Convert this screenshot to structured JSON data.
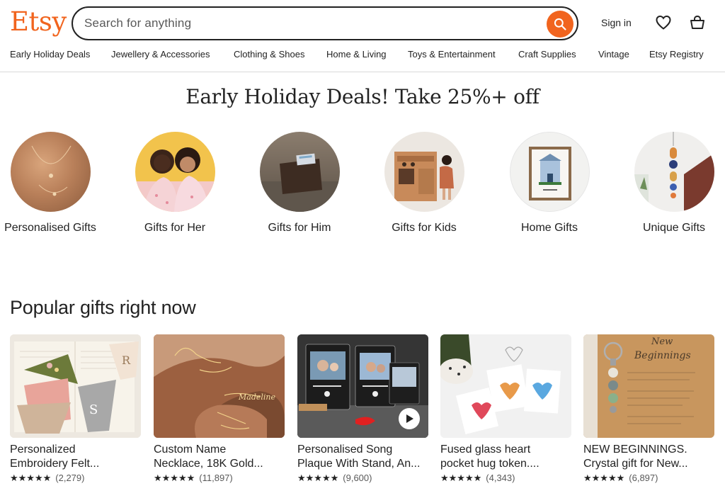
{
  "header": {
    "logo": "Etsy",
    "search_placeholder": "Search for anything",
    "signin_label": "Sign in",
    "icons": [
      "search-icon",
      "heart-icon",
      "shopping-bag-icon"
    ],
    "accent_color": "#f1641e"
  },
  "nav": {
    "items": [
      "Early Holiday Deals",
      "Jewellery & Accessories",
      "Clothing & Shoes",
      "Home & Living",
      "Toys & Entertainment",
      "Craft Supplies",
      "Vintage",
      "Etsy Registry"
    ]
  },
  "banner": {
    "title": "Early Holiday Deals! Take 25%+ off",
    "categories": [
      {
        "label": "Personalised Gifts"
      },
      {
        "label": "Gifts for Her"
      },
      {
        "label": "Gifts for Him"
      },
      {
        "label": "Gifts for Kids"
      },
      {
        "label": "Home Gifts"
      },
      {
        "label": "Unique Gifts"
      }
    ]
  },
  "popular": {
    "title": "Popular gifts right now",
    "items": [
      {
        "title_line1": "Personalized",
        "title_line2": "Embroidery Felt...",
        "stars": "★★★★★",
        "reviews": "(2,279)"
      },
      {
        "title_line1": "Custom Name",
        "title_line2": "Necklace, 18K Gold...",
        "stars": "★★★★★",
        "reviews": "(11,897)"
      },
      {
        "title_line1": "Personalised Song",
        "title_line2": "Plaque With Stand, An...",
        "stars": "★★★★★",
        "reviews": "(9,600)"
      },
      {
        "title_line1": "Fused glass heart",
        "title_line2": "pocket hug token....",
        "stars": "★★★★★",
        "reviews": "(4,343)"
      },
      {
        "title_line1": "NEW BEGINNINGS.",
        "title_line2": "Crystal gift for New...",
        "stars": "★★★★★",
        "reviews": "(6,897)"
      }
    ]
  }
}
